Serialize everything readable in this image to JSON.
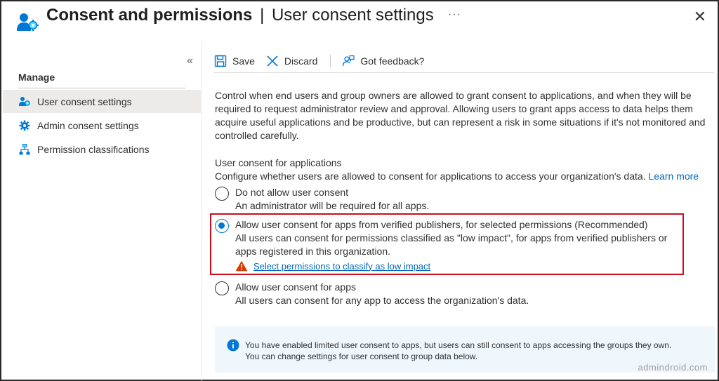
{
  "header": {
    "title_main": "Consent and permissions",
    "title_sep": "|",
    "title_sub": "User consent settings",
    "more": "···",
    "close": "✕"
  },
  "sidebar": {
    "collapse": "«",
    "section_label": "Manage",
    "items": [
      {
        "label": "User consent settings",
        "icon": "gear-person-icon",
        "active": true
      },
      {
        "label": "Admin consent settings",
        "icon": "gear-icon",
        "active": false
      },
      {
        "label": "Permission classifications",
        "icon": "hierarchy-icon",
        "active": false
      }
    ]
  },
  "toolbar": {
    "save_label": "Save",
    "discard_label": "Discard",
    "feedback_label": "Got feedback?"
  },
  "content": {
    "description": "Control when end users and group owners are allowed to grant consent to applications, and when they will be required to request administrator review and approval. Allowing users to grant apps access to data helps them acquire useful applications and be productive, but can represent a risk in some situations if it's not monitored and controlled carefully.",
    "section_title": "User consent for applications",
    "section_desc": "Configure whether users are allowed to consent for applications to access your organization's data.",
    "learn_more": "Learn more",
    "options": [
      {
        "label": "Do not allow user consent",
        "sub": "An administrator will be required for all apps.",
        "checked": false
      },
      {
        "label": "Allow user consent for apps from verified publishers, for selected permissions (Recommended)",
        "sub": "All users can consent for permissions classified as \"low impact\", for apps from verified publishers or apps registered in this organization.",
        "checked": true
      },
      {
        "label": "Allow user consent for apps",
        "sub": "All users can consent for any app to access the organization's data.",
        "checked": false
      }
    ],
    "warning_link": "Select permissions to classify as low impact"
  },
  "info": {
    "line1": "You have enabled limited user consent to apps, but users can still consent to apps accessing the groups they own.",
    "line2": "You can change settings for user consent to group data below."
  },
  "watermark": "admindroid.com",
  "colors": {
    "accent": "#0078d4",
    "link": "#0067b8",
    "highlight_border": "#c50f1f",
    "warning": "#d83b01",
    "info_bg": "#eff6fc"
  }
}
